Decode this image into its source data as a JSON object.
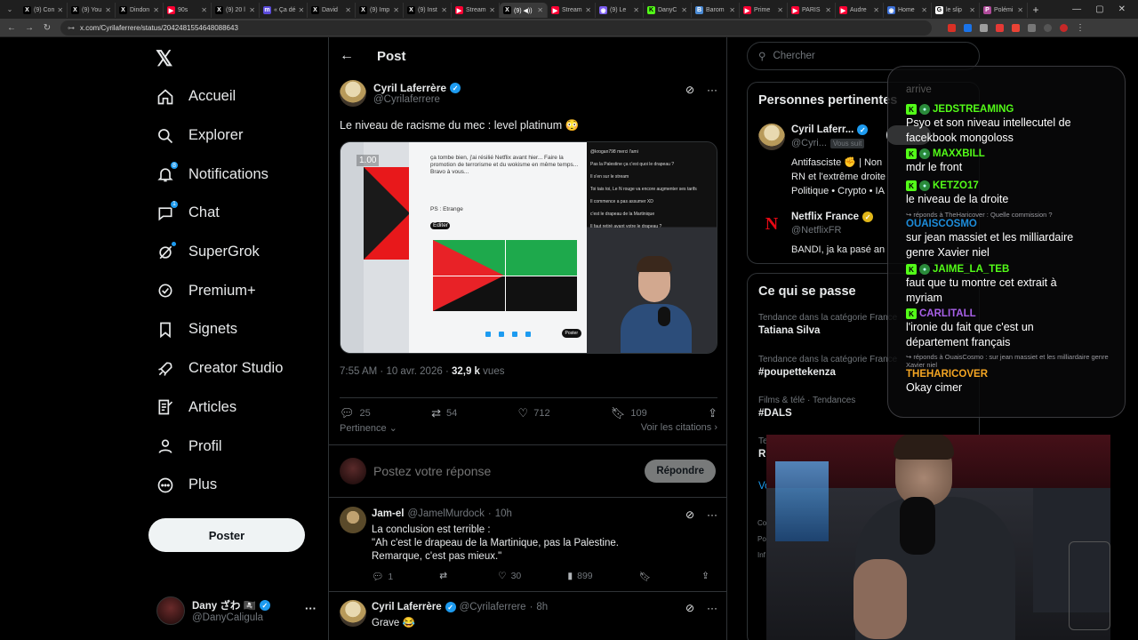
{
  "browser": {
    "tabs": [
      {
        "label": "(9) Con",
        "fav_color": "#000000",
        "fav_glyph": "X"
      },
      {
        "label": "(9) You",
        "fav_color": "#000000",
        "fav_glyph": "X"
      },
      {
        "label": "Dindon",
        "fav_color": "#000000",
        "fav_glyph": "X"
      },
      {
        "label": "90s",
        "fav_color": "#ff0033",
        "fav_glyph": "▶"
      },
      {
        "label": "(9) 20 l",
        "fav_color": "#000000",
        "fav_glyph": "X"
      },
      {
        "label": "« Ça dé",
        "fav_color": "#5b4bdb",
        "fav_glyph": "m"
      },
      {
        "label": "David",
        "fav_color": "#000000",
        "fav_glyph": "X"
      },
      {
        "label": "(9) Imp",
        "fav_color": "#000000",
        "fav_glyph": "X"
      },
      {
        "label": "(9) Inst",
        "fav_color": "#000000",
        "fav_glyph": "X"
      },
      {
        "label": "Stream",
        "fav_color": "#ff0033",
        "fav_glyph": "▶"
      },
      {
        "label": "(9) ◀))",
        "fav_color": "#000000",
        "fav_glyph": "X",
        "active": true
      },
      {
        "label": "Stream",
        "fav_color": "#ff0033",
        "fav_glyph": "▶"
      },
      {
        "label": "(9) Le",
        "fav_color": "#7a5cf0",
        "fav_glyph": "◉"
      },
      {
        "label": "DanyC",
        "fav_color": "#53fc18",
        "fav_glyph": "K"
      },
      {
        "label": "Barom",
        "fav_color": "#4a8ad4",
        "fav_glyph": "B"
      },
      {
        "label": "Prime",
        "fav_color": "#ff0033",
        "fav_glyph": "▶"
      },
      {
        "label": "PARIS",
        "fav_color": "#ff0033",
        "fav_glyph": "▶"
      },
      {
        "label": "Audre",
        "fav_color": "#ff0033",
        "fav_glyph": "▶"
      },
      {
        "label": "Home",
        "fav_color": "#3b6fd6",
        "fav_glyph": "◉"
      },
      {
        "label": "le slip",
        "fav_color": "#ffffff",
        "fav_glyph": "G"
      },
      {
        "label": "Polémi",
        "fav_color": "#b04a9a",
        "fav_glyph": "P"
      }
    ],
    "new_tab": "+",
    "url": "x.com/Cyrilaferrere/status/2042481554648088643"
  },
  "nav": {
    "logo": "𝕏",
    "items": [
      {
        "label": "Accueil",
        "icon": "home-icon"
      },
      {
        "label": "Explorer",
        "icon": "search-icon"
      },
      {
        "label": "Notifications",
        "icon": "bell-icon",
        "badge": "8"
      },
      {
        "label": "Chat",
        "icon": "chat-icon",
        "badge": "1"
      },
      {
        "label": "SuperGrok",
        "icon": "grok-icon",
        "dot": true
      },
      {
        "label": "Premium+",
        "icon": "premium-icon"
      },
      {
        "label": "Signets",
        "icon": "bookmark-icon"
      },
      {
        "label": "Creator Studio",
        "icon": "rocket-icon"
      },
      {
        "label": "Articles",
        "icon": "article-icon"
      },
      {
        "label": "Profil",
        "icon": "person-icon"
      },
      {
        "label": "Plus",
        "icon": "more-circle-icon"
      }
    ],
    "post_button": "Poster",
    "account": {
      "name": "Dany ざわ 🏴‍☠️",
      "handle": "@DanyCaligula",
      "more": "···"
    }
  },
  "post": {
    "header_title": "Post",
    "author_name": "Cyril Laferrère",
    "author_handle": "@Cyrilaferrere",
    "text": "Le niveau de racisme du mec : level platinum 😳",
    "media": {
      "timecode": "1.00",
      "card_text": "ça tombe bien, j'ai résilié Netflix avant hier... Faire la promotion de terrorisme et du wokisme en même temps... Bravo à vous...",
      "card_ps": "PS : Etrange",
      "card_edit": "Éditer",
      "card_post": "Poster",
      "chat_lines": [
        "@krogan798 merci l'ami",
        "Pas la Palestine ça c'est quoi le drapeau ?",
        "Il s'en sur le stream",
        "Toi tais toi, Le N rouge va encore augmenter ses tarifs",
        "Il commence a pas assumer XD",
        "c'est le drapeau de la Martinique",
        "Il faut retiré avant votre le drapeau ?"
      ]
    },
    "time": "7:55 AM",
    "date": "10 avr. 2026",
    "views_count": "32,9 k",
    "views_label": "vues",
    "actions": {
      "replies": "25",
      "reposts": "54",
      "likes": "712",
      "bookmarks": "109"
    },
    "sort_label": "Pertinence",
    "quotes_label": "Voir les citations",
    "reply_placeholder": "Postez votre réponse",
    "reply_button": "Répondre"
  },
  "replies": [
    {
      "name": "Jam-el",
      "handle": "@JamelMurdock",
      "time": "10h",
      "lines": [
        "La conclusion est terrible :",
        "\"Ah c'est le drapeau de la Martinique, pas la Palestine.",
        "Remarque, c'est pas mieux.\""
      ],
      "replies": "1",
      "reposts": "",
      "likes": "30",
      "views": "899"
    },
    {
      "name": "Cyril Laferrère",
      "handle": "@Cyrilaferrere",
      "time": "8h",
      "lines": [
        "Grave 😂"
      ]
    }
  ],
  "sidebar": {
    "search_placeholder": "Chercher",
    "people_title": "Personnes pertinentes",
    "people": [
      {
        "name": "Cyril Laferr...",
        "handle": "@Cyri...",
        "follows_you": "Vous suit",
        "bio": [
          "Antifasciste ✊ | Non",
          "RN et l'extrême droite",
          "Politique • Crypto • IA"
        ]
      },
      {
        "name": "Netflix France",
        "handle": "@NetflixFR",
        "bio": [
          "BANDI, ja ka pasé an"
        ]
      }
    ],
    "happening_title": "Ce qui se passe",
    "trends": [
      {
        "context": "Tendance dans la catégorie France",
        "title": "Tatiana Silva"
      },
      {
        "context": "Tendance dans la catégorie France",
        "title": "#poupettekenza"
      },
      {
        "context": "Films & télé · Tendances",
        "title": "#DALS"
      }
    ],
    "trunc_trend_context": "Te",
    "trunc_trend_title": "Ru",
    "trunc_show_more": "Vo",
    "footer_1": "Co",
    "footer_2": "Po",
    "footer_3": "Inf"
  },
  "chat_overlay": {
    "faded": "arrive",
    "messages": [
      {
        "user": "JEDSTREAMING",
        "color": "#53fc18",
        "text": "Psyo et son niveau intellecutel de",
        "text2": "facekbook mongoloss"
      },
      {
        "user": "MAXXBILL",
        "color": "#53fc18",
        "text": "mdr le front"
      },
      {
        "user": "KETZO17",
        "color": "#53fc18",
        "text": "niveau de la droite",
        "prefix": "le "
      },
      {
        "reply_to": "↪ réponds à TheHaricover : Quelle commission ?",
        "user": "OUAISCOSMO",
        "color": "#1d8ddb",
        "text": "sur jean massiet et les milliardaire",
        "text2": "genre Xavier niel"
      },
      {
        "user": "JAIME_LA_TEB",
        "color": "#53fc18",
        "text": "faut que tu montre cet extrait à",
        "text2": "myriam"
      },
      {
        "user": "CARLITALL",
        "color": "#a860e8",
        "text": "l'ironie du fait que c'est un",
        "text2": "département français"
      },
      {
        "reply_to": "↪ réponds à OuaisCosmo : sur jean massiet et les milliardaire genre Xavier niel",
        "user": "THEHARICOVER",
        "color": "#f5a623",
        "text": "Okay cimer"
      }
    ]
  }
}
